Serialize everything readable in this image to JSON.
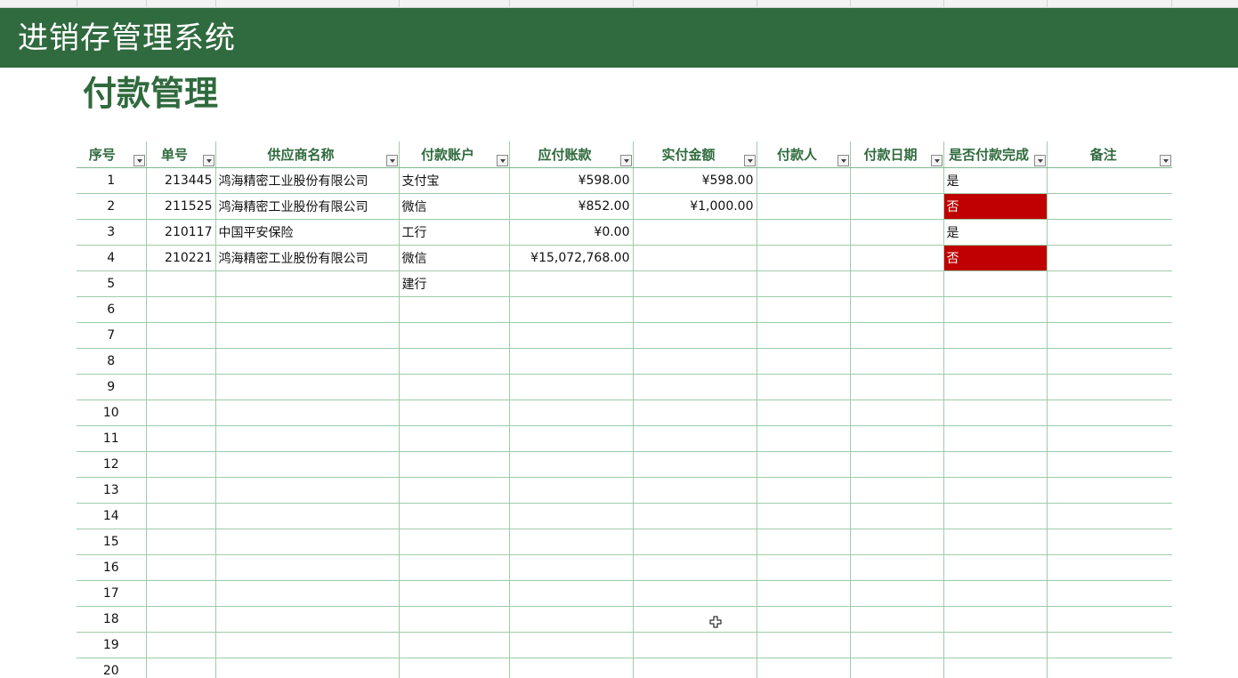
{
  "app": {
    "title": "进销存管理系统"
  },
  "page": {
    "title": "付款管理"
  },
  "colors": {
    "banner": "#306a3f",
    "heading_text": "#2f6a3d",
    "grid_line": "#9fcca8",
    "status_no_fill": "#c00000"
  },
  "table": {
    "columns": [
      "序号",
      "单号",
      "供应商名称",
      "付款账户",
      "应付账款",
      "实付金额",
      "付款人",
      "付款日期",
      "是否付款完成",
      "备注"
    ],
    "rows": [
      {
        "seq": "1",
        "order_no": "213445",
        "supplier": "鸿海精密工业股份有限公司",
        "account": "支付宝",
        "payable": "¥598.00",
        "paid": "¥598.00",
        "payer": "",
        "date": "",
        "done": "是",
        "note": ""
      },
      {
        "seq": "2",
        "order_no": "211525",
        "supplier": "鸿海精密工业股份有限公司",
        "account": "微信",
        "payable": "¥852.00",
        "paid": "¥1,000.00",
        "payer": "",
        "date": "",
        "done": "否",
        "note": ""
      },
      {
        "seq": "3",
        "order_no": "210117",
        "supplier": "中国平安保险",
        "account": "工行",
        "payable": "¥0.00",
        "paid": "",
        "payer": "",
        "date": "",
        "done": "是",
        "note": ""
      },
      {
        "seq": "4",
        "order_no": "210221",
        "supplier": "鸿海精密工业股份有限公司",
        "account": "微信",
        "payable": "¥15,072,768.00",
        "paid": "",
        "payer": "",
        "date": "",
        "done": "否",
        "note": ""
      },
      {
        "seq": "5",
        "order_no": "",
        "supplier": "",
        "account": "建行",
        "payable": "",
        "paid": "",
        "payer": "",
        "date": "",
        "done": "",
        "note": ""
      },
      {
        "seq": "6",
        "order_no": "",
        "supplier": "",
        "account": "",
        "payable": "",
        "paid": "",
        "payer": "",
        "date": "",
        "done": "",
        "note": ""
      },
      {
        "seq": "7",
        "order_no": "",
        "supplier": "",
        "account": "",
        "payable": "",
        "paid": "",
        "payer": "",
        "date": "",
        "done": "",
        "note": ""
      },
      {
        "seq": "8",
        "order_no": "",
        "supplier": "",
        "account": "",
        "payable": "",
        "paid": "",
        "payer": "",
        "date": "",
        "done": "",
        "note": ""
      },
      {
        "seq": "9",
        "order_no": "",
        "supplier": "",
        "account": "",
        "payable": "",
        "paid": "",
        "payer": "",
        "date": "",
        "done": "",
        "note": ""
      },
      {
        "seq": "10",
        "order_no": "",
        "supplier": "",
        "account": "",
        "payable": "",
        "paid": "",
        "payer": "",
        "date": "",
        "done": "",
        "note": ""
      },
      {
        "seq": "11",
        "order_no": "",
        "supplier": "",
        "account": "",
        "payable": "",
        "paid": "",
        "payer": "",
        "date": "",
        "done": "",
        "note": ""
      },
      {
        "seq": "12",
        "order_no": "",
        "supplier": "",
        "account": "",
        "payable": "",
        "paid": "",
        "payer": "",
        "date": "",
        "done": "",
        "note": ""
      },
      {
        "seq": "13",
        "order_no": "",
        "supplier": "",
        "account": "",
        "payable": "",
        "paid": "",
        "payer": "",
        "date": "",
        "done": "",
        "note": ""
      },
      {
        "seq": "14",
        "order_no": "",
        "supplier": "",
        "account": "",
        "payable": "",
        "paid": "",
        "payer": "",
        "date": "",
        "done": "",
        "note": ""
      },
      {
        "seq": "15",
        "order_no": "",
        "supplier": "",
        "account": "",
        "payable": "",
        "paid": "",
        "payer": "",
        "date": "",
        "done": "",
        "note": ""
      },
      {
        "seq": "16",
        "order_no": "",
        "supplier": "",
        "account": "",
        "payable": "",
        "paid": "",
        "payer": "",
        "date": "",
        "done": "",
        "note": ""
      },
      {
        "seq": "17",
        "order_no": "",
        "supplier": "",
        "account": "",
        "payable": "",
        "paid": "",
        "payer": "",
        "date": "",
        "done": "",
        "note": ""
      },
      {
        "seq": "18",
        "order_no": "",
        "supplier": "",
        "account": "",
        "payable": "",
        "paid": "",
        "payer": "",
        "date": "",
        "done": "",
        "note": ""
      },
      {
        "seq": "19",
        "order_no": "",
        "supplier": "",
        "account": "",
        "payable": "",
        "paid": "",
        "payer": "",
        "date": "",
        "done": "",
        "note": ""
      },
      {
        "seq": "20",
        "order_no": "",
        "supplier": "",
        "account": "",
        "payable": "",
        "paid": "",
        "payer": "",
        "date": "",
        "done": "",
        "note": ""
      }
    ]
  },
  "icons": {
    "filter": "chevron-down-icon",
    "cursor": "move-cursor-icon"
  }
}
